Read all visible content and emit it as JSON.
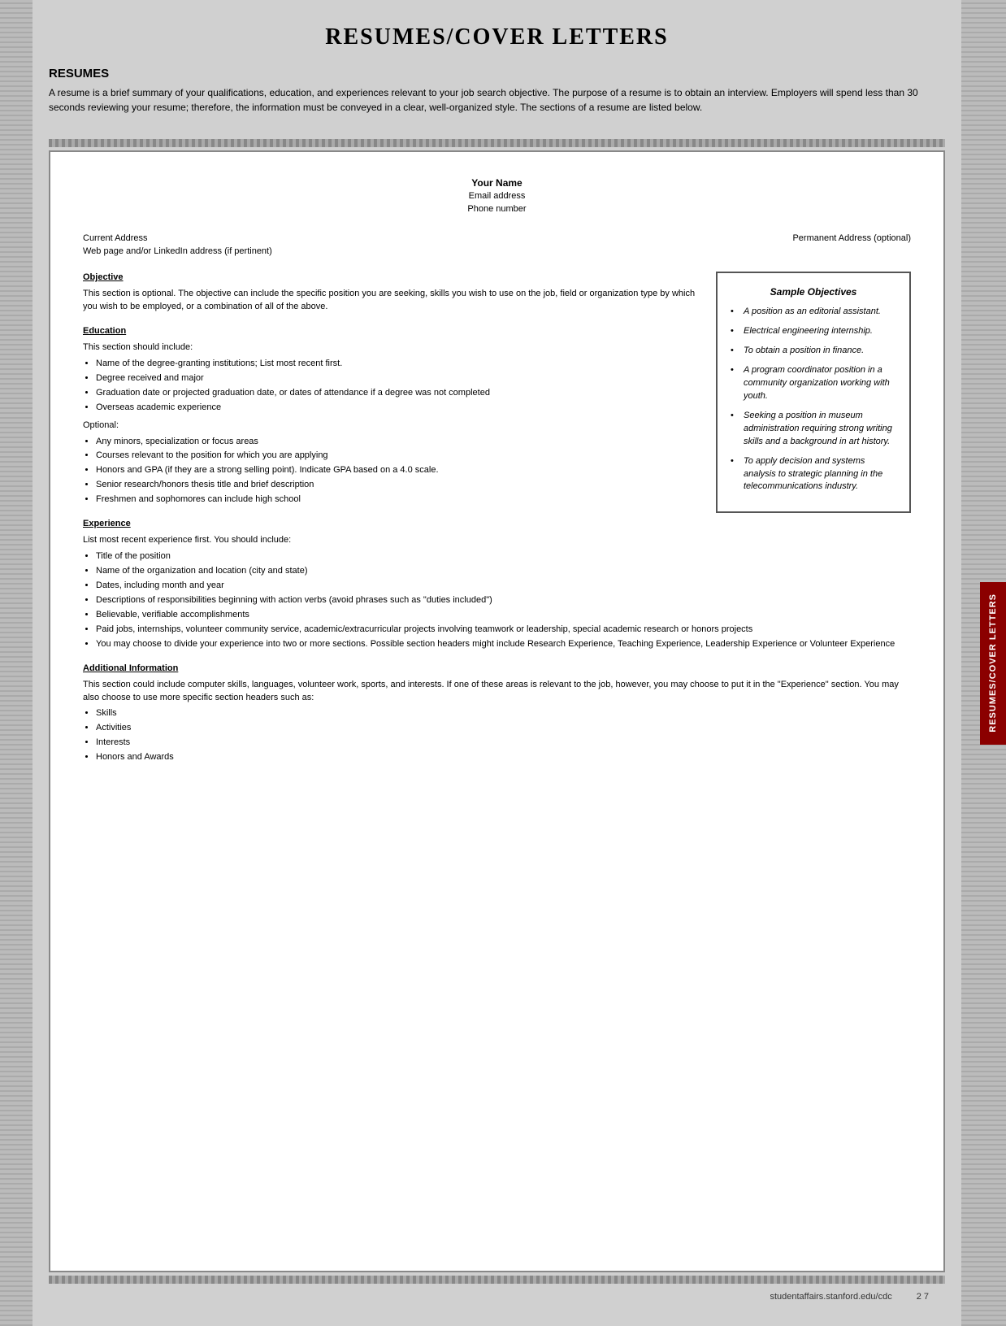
{
  "page": {
    "title": "RESUMES/COVER LETTERS"
  },
  "resumes_section": {
    "heading": "RESUMES",
    "intro": "A resume is a brief summary of your qualifications, education, and experiences relevant to your job search objective. The purpose of a resume is to obtain an interview. Employers will spend less than 30 seconds reviewing your resume; therefore, the information must be conveyed in a clear, well-organized style. The sections of a resume are listed below."
  },
  "document": {
    "name": "Your Name",
    "email": "Email address",
    "phone": "Phone number",
    "current_address": "Current Address",
    "current_address_sub": "Web page and/or LinkedIn address (if pertinent)",
    "permanent_address": "Permanent Address (optional)",
    "objective_title": "Objective",
    "objective_text": "This section is optional. The objective can include the specific position you are seeking, skills you wish to use on the job, field or organization type by which you wish to be employed, or a combination of all of the above.",
    "education_title": "Education",
    "education_intro": "This section should include:",
    "education_items": [
      "Name of the degree-granting institutions; List most recent first.",
      "Degree received and major",
      "Graduation date or projected graduation date, or dates of attendance if a degree was not completed",
      "Overseas academic experience"
    ],
    "education_optional": "Optional:",
    "education_optional_items": [
      "Any minors, specialization or focus areas",
      "Courses relevant to the position for which you are applying",
      "Honors and GPA (if they are a strong selling point). Indicate GPA based on a 4.0 scale.",
      "Senior research/honors thesis title and brief description",
      "Freshmen and sophomores can include high school"
    ],
    "experience_title": "Experience",
    "experience_intro": "List most recent experience first. You should include:",
    "experience_items": [
      "Title of the position",
      "Name of the organization and location (city and state)",
      "Dates, including month and year",
      "Descriptions of responsibilities beginning with action verbs (avoid phrases such as \"duties included\")",
      "Believable, verifiable accomplishments",
      "Paid jobs, internships, volunteer community service, academic/extracurricular projects involving teamwork or leadership, special academic research or honors projects",
      "You may choose to divide your experience into two or more sections. Possible section headers might include Research Experience, Teaching Experience, Leadership Experience or Volunteer Experience"
    ],
    "additional_title": "Additional Information",
    "additional_text": "This section could include computer skills, languages, volunteer work, sports, and interests. If one of these areas is relevant to the job, however, you may choose to put it in the \"Experience\" section. You may also choose to use more specific section headers such as:",
    "additional_items": [
      "Skills",
      "Activities",
      "Interests",
      "Honors and Awards"
    ]
  },
  "sample_objectives": {
    "title": "Sample Objectives",
    "items": [
      "A position as an editorial assistant.",
      "Electrical engineering internship.",
      "To obtain a position in finance.",
      "A program coordinator position in a community organization working with youth.",
      "Seeking a position in museum administration requiring strong writing skills and a background in art history.",
      "To apply decision and systems analysis to strategic planning in the telecommunications industry."
    ]
  },
  "footer": {
    "url": "studentaffairs.stanford.edu/cdc",
    "page": "2 7"
  },
  "side_tab": {
    "label": "RESUMES/COVER LETTERS"
  }
}
